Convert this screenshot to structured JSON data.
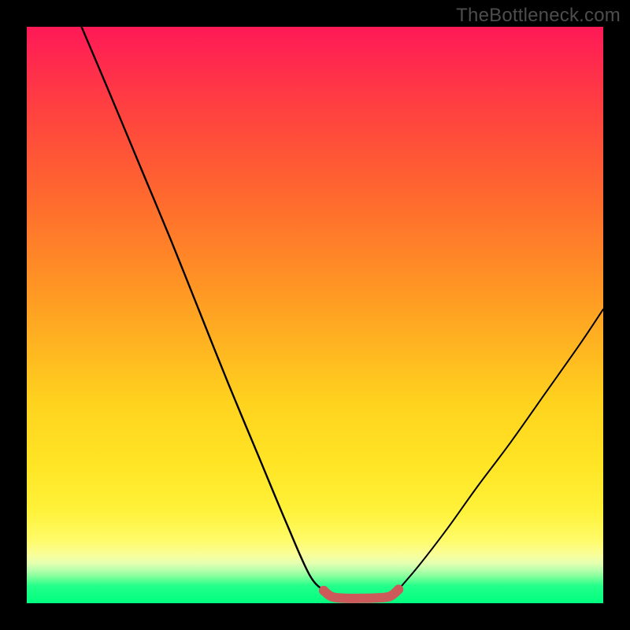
{
  "watermark": {
    "text": "TheBottleneck.com"
  },
  "colors": {
    "curve_stroke": "#000000",
    "nub_stroke": "#cc5a5a",
    "nub_fill": "none"
  },
  "chart_data": {
    "type": "line",
    "title": "",
    "xlabel": "",
    "ylabel": "",
    "xlim": [
      0,
      100
    ],
    "ylim": [
      0,
      100
    ],
    "grid": false,
    "legend": false,
    "series": [
      {
        "name": "left-branch",
        "x": [
          9.5,
          15,
          20,
          25,
          30,
          35,
          40,
          45,
          49,
          51.5
        ],
        "y": [
          100,
          87,
          75,
          63,
          50.5,
          38,
          26,
          14,
          5,
          2.2
        ]
      },
      {
        "name": "bottom-nub",
        "x": [
          51.5,
          53,
          55.5,
          58,
          60.5,
          63,
          64.5
        ],
        "y": [
          2.2,
          1.1,
          0.85,
          0.85,
          0.9,
          1.2,
          2.4
        ]
      },
      {
        "name": "right-branch",
        "x": [
          64.5,
          68,
          73,
          78,
          84,
          90,
          96,
          100
        ],
        "y": [
          2.4,
          6.5,
          13,
          20,
          28,
          36.5,
          45,
          51
        ]
      }
    ],
    "annotations": []
  }
}
